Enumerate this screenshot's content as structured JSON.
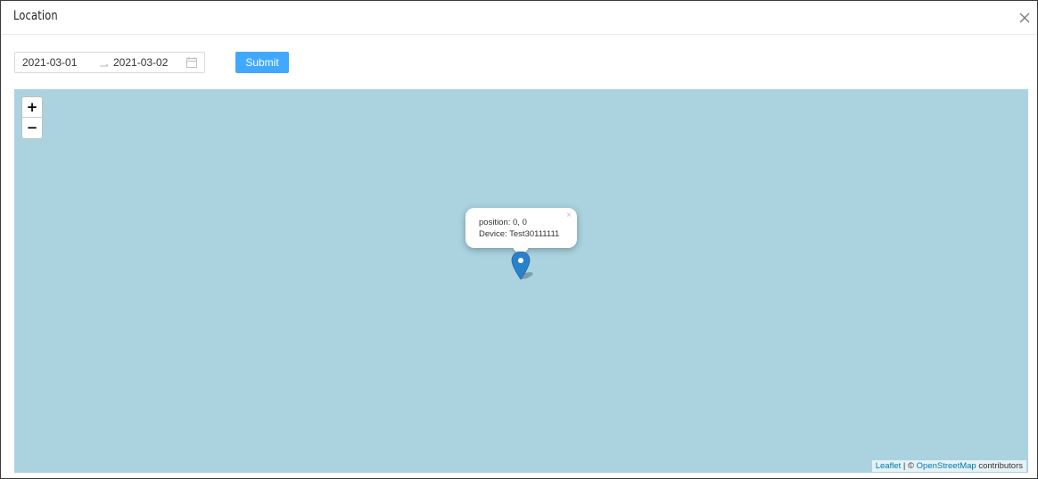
{
  "modal": {
    "title": "Location",
    "close_icon": "close-icon"
  },
  "toolbar": {
    "date_start": "2021-03-01",
    "date_separator": "→",
    "date_end": "2021-03-02",
    "calendar_icon": "calendar-icon",
    "submit_label": "Submit",
    "accent_color": "#40a9ff"
  },
  "map": {
    "background_color": "#aad3df",
    "zoom_in_label": "+",
    "zoom_out_label": "−",
    "popup": {
      "line1": "position: 0, 0",
      "line2": "Device: Test30111111",
      "close_label": "×"
    },
    "marker_icon": "map-pin-icon",
    "marker_color": "#2a81cb",
    "attribution": {
      "leaflet": "Leaflet",
      "separator": "| ©",
      "osm": "OpenStreetMap",
      "suffix": "contributors"
    }
  }
}
